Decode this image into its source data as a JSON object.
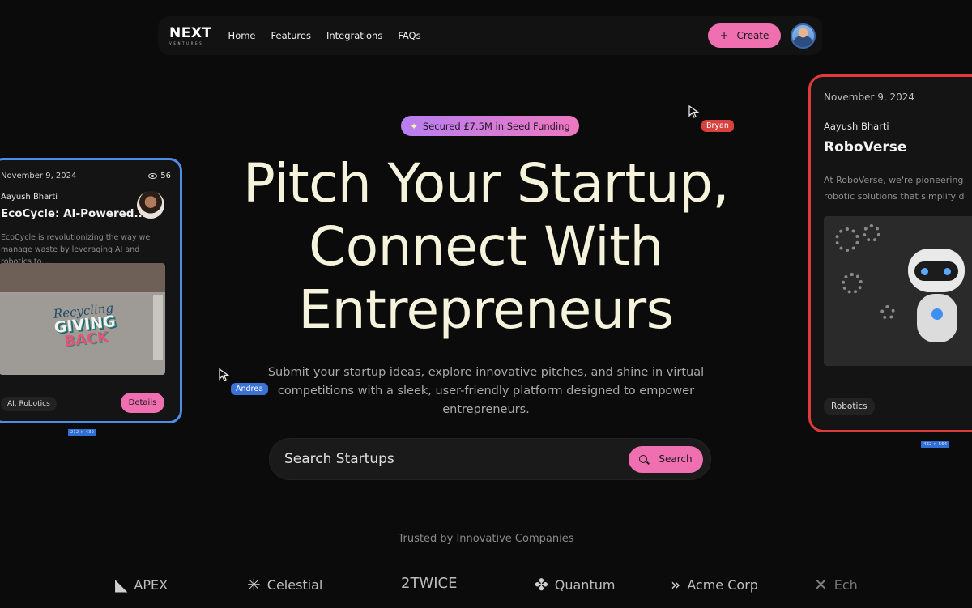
{
  "nav": {
    "logo_main": "NEXT",
    "logo_sub": "VENTURES",
    "links": [
      "Home",
      "Features",
      "Integrations",
      "FAQs"
    ],
    "create_label": "Create",
    "create_icon": "plus-icon",
    "avatar_icon": "user-avatar"
  },
  "badge": {
    "icon": "sparkle-icon",
    "text": "Secured £7.5M in Seed Funding"
  },
  "hero": {
    "title_line1": "Pitch Your Startup,",
    "title_line2": "Connect With",
    "title_line3": "Entrepreneurs",
    "subtitle": "Submit your startup ideas, explore innovative pitches, and shine in virtual competitions with a sleek, user-friendly platform designed to empower entrepreneurs."
  },
  "search": {
    "placeholder": "Search Startups",
    "button_label": "Search",
    "button_icon": "search-icon"
  },
  "trusted": {
    "heading": "Trusted by Innovative Companies",
    "companies": [
      {
        "name": "APEX",
        "icon": "apex-logo-icon"
      },
      {
        "name": "Celestial",
        "icon": "snowflake-logo-icon"
      },
      {
        "name": "2TWICE",
        "icon": ""
      },
      {
        "name": "Quantum",
        "icon": "clover-logo-icon"
      },
      {
        "name": "Acme Corp",
        "icon": "chevrons-logo-icon"
      },
      {
        "name": "Ech",
        "icon": "x-logo-icon"
      }
    ]
  },
  "card_left": {
    "date": "November 9, 2024",
    "views": "56",
    "author": "Aayush Bharti",
    "title": "EcoCycle: AI-Powered...",
    "description": "EcoCycle is revolutionizing the way we manage waste by leveraging AI and robotics to...",
    "graffiti_1": "Recycling",
    "graffiti_2": "GIVING",
    "graffiti_3": "BACK",
    "tag": "AI, Robotics",
    "details_label": "Details",
    "dimension_label": "212 × 430",
    "border_color": "#4d8fe6"
  },
  "card_right": {
    "date": "November 9, 2024",
    "author": "Aayush Bharti",
    "title": "RoboVerse",
    "description_line1": "At RoboVerse, we're pioneering",
    "description_line2": "robotic solutions that simplify d",
    "tag": "Robotics",
    "dimension_label": "432 × 564",
    "border_color": "#e13a3a"
  },
  "cursors": [
    {
      "name": "Bryan",
      "color": "#d9413f"
    },
    {
      "name": "Andrea",
      "color": "#3a72d8"
    }
  ],
  "colors": {
    "accent": "#ef6fb0",
    "background": "#0b0b0b",
    "title": "#f5f3dc"
  }
}
